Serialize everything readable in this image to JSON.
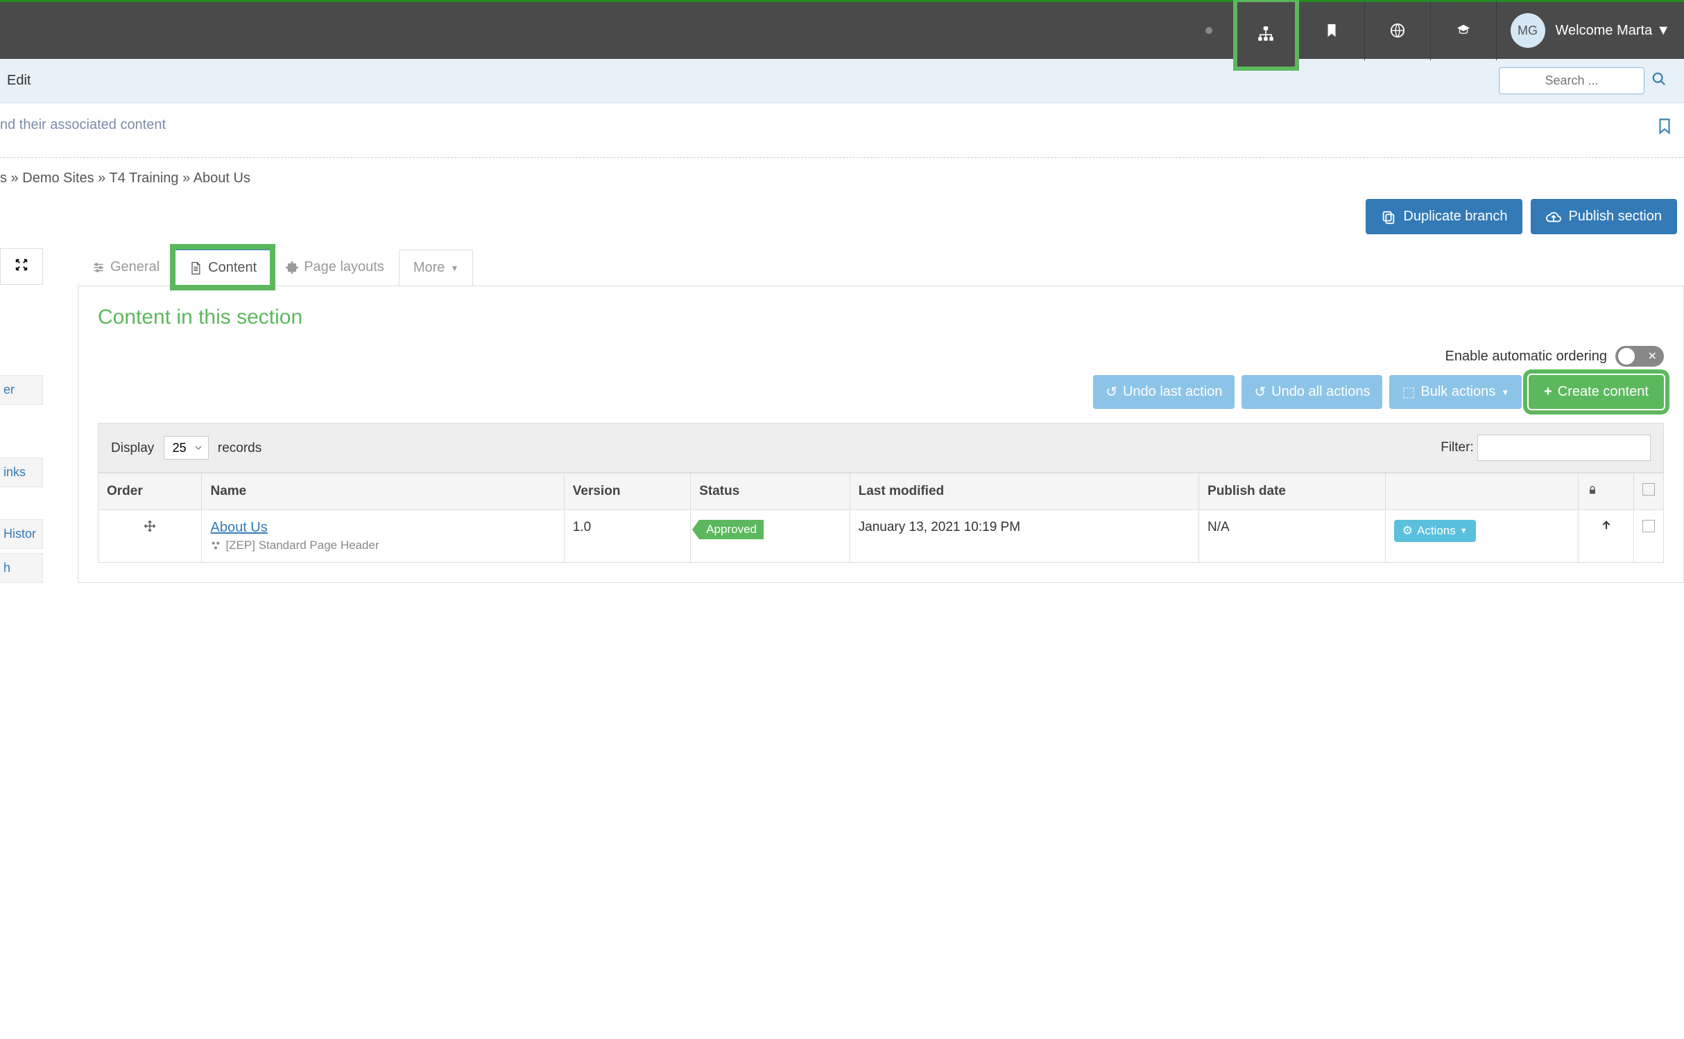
{
  "header": {
    "user_initials": "MG",
    "welcome": "Welcome Marta"
  },
  "editbar": {
    "title": "Edit",
    "search_placeholder": "Search ..."
  },
  "description": "nd their associated content",
  "breadcrumb": {
    "part1": "s",
    "part2": "Demo Sites",
    "part3": "T4 Training",
    "part4": "About Us",
    "sep": " » "
  },
  "actions": {
    "duplicate": "Duplicate branch",
    "publish": "Publish section"
  },
  "sidebar": {
    "items": [
      "er",
      "inks",
      "Histor",
      "h"
    ]
  },
  "tabs": {
    "general": "General",
    "content": "Content",
    "page_layouts": "Page layouts",
    "more": "More"
  },
  "panel": {
    "title": "Content in this section",
    "enable_ordering": "Enable automatic ordering",
    "undo_last": "Undo last action",
    "undo_all": "Undo all actions",
    "bulk_actions": "Bulk actions",
    "create_content": "Create content"
  },
  "table_controls": {
    "display": "Display",
    "display_value": "25",
    "records": "records",
    "filter": "Filter:"
  },
  "table": {
    "headers": {
      "order": "Order",
      "name": "Name",
      "version": "Version",
      "status": "Status",
      "last_modified": "Last modified",
      "publish_date": "Publish date"
    },
    "rows": [
      {
        "name": "About Us",
        "template": "[ZEP] Standard Page Header",
        "version": "1.0",
        "status": "Approved",
        "last_modified": "January 13, 2021 10:19 PM",
        "publish_date": "N/A",
        "actions_label": "Actions"
      }
    ]
  }
}
